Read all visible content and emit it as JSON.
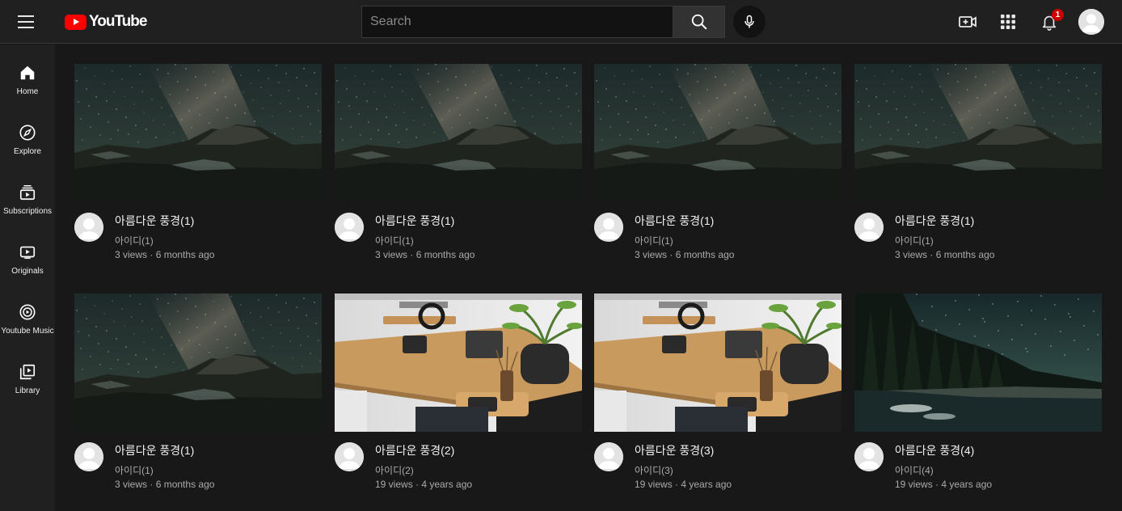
{
  "header": {
    "logo_text": "YouTube",
    "search_placeholder": "Search",
    "notification_count": "1"
  },
  "sidebar": {
    "items": [
      {
        "label": "Home",
        "icon": "home-icon"
      },
      {
        "label": "Explore",
        "icon": "compass-icon"
      },
      {
        "label": "Subscriptions",
        "icon": "subscriptions-icon"
      },
      {
        "label": "Originals",
        "icon": "originals-icon"
      },
      {
        "label": "Youtube Music",
        "icon": "music-icon"
      },
      {
        "label": "Library",
        "icon": "library-icon"
      }
    ]
  },
  "videos": [
    {
      "title": "아름다운 풍경(1)",
      "channel": "아이디(1)",
      "views": "3 views",
      "age": "6 months ago",
      "thumb": "milky-way-mountain"
    },
    {
      "title": "아름다운 풍경(1)",
      "channel": "아이디(1)",
      "views": "3 views",
      "age": "6 months ago",
      "thumb": "milky-way-mountain"
    },
    {
      "title": "아름다운 풍경(1)",
      "channel": "아이디(1)",
      "views": "3 views",
      "age": "6 months ago",
      "thumb": "milky-way-mountain"
    },
    {
      "title": "아름다운 풍경(1)",
      "channel": "아이디(1)",
      "views": "3 views",
      "age": "6 months ago",
      "thumb": "milky-way-mountain"
    },
    {
      "title": "아름다운 풍경(1)",
      "channel": "아이디(1)",
      "views": "3 views",
      "age": "6 months ago",
      "thumb": "milky-way-mountain"
    },
    {
      "title": "아름다운 풍경(2)",
      "channel": "아이디(2)",
      "views": "19 views",
      "age": "4 years ago",
      "thumb": "desk-setup"
    },
    {
      "title": "아름다운 풍경(3)",
      "channel": "아이디(3)",
      "views": "19 views",
      "age": "4 years ago",
      "thumb": "desk-setup"
    },
    {
      "title": "아름다운 풍경(4)",
      "channel": "아이디(4)",
      "views": "19 views",
      "age": "4 years ago",
      "thumb": "starry-lake"
    }
  ],
  "meta_separator": "·",
  "colors": {
    "background": "#181818",
    "header": "#202020",
    "brand_red": "#ff0000",
    "secondary_text": "#aaaaaa"
  }
}
